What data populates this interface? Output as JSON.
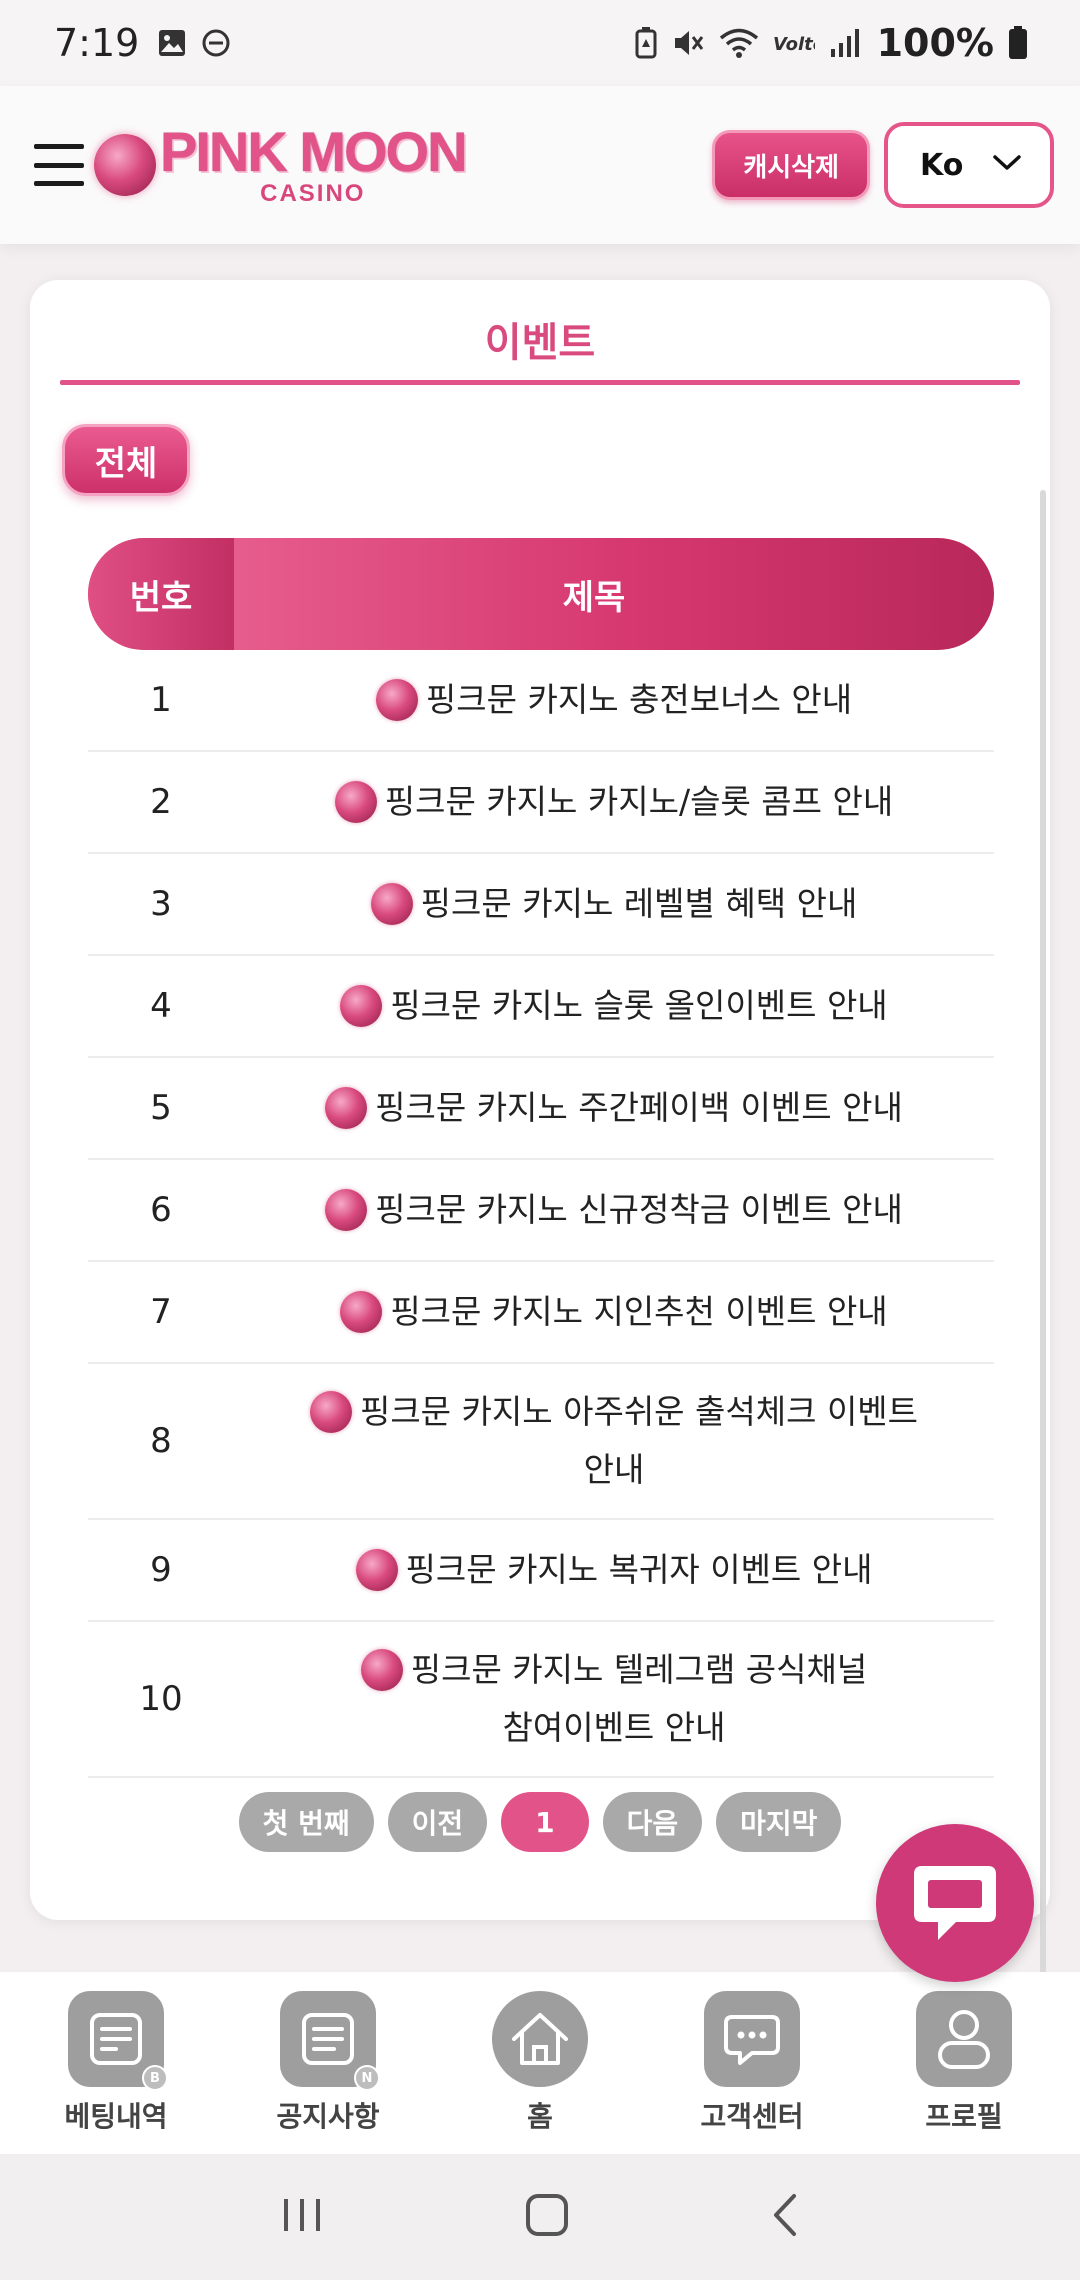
{
  "status_bar": {
    "time": "7:19",
    "battery_text": "100%",
    "left_icons": [
      "image-icon",
      "dnd-icon"
    ],
    "right_icons": [
      "battery-saver-icon",
      "mute-icon",
      "wifi-icon",
      "volte-icon",
      "signal-icon",
      "battery-icon"
    ]
  },
  "header": {
    "logo_main": "PINK MOON",
    "logo_sub": "CASINO",
    "cash_button": "캐시삭제",
    "language": "Ko"
  },
  "page": {
    "title": "이벤트",
    "filter_all": "전체"
  },
  "table": {
    "col_no": "번호",
    "col_title": "제목",
    "rows": [
      {
        "no": "1",
        "title": "핑크문 카지노 충전보너스 안내"
      },
      {
        "no": "2",
        "title": "핑크문 카지노 카지노/슬롯 콤프 안내"
      },
      {
        "no": "3",
        "title": "핑크문 카지노 레벨별 혜택 안내"
      },
      {
        "no": "4",
        "title": "핑크문 카지노 슬롯 올인이벤트 안내"
      },
      {
        "no": "5",
        "title": "핑크문 카지노 주간페이백 이벤트 안내"
      },
      {
        "no": "6",
        "title": "핑크문 카지노 신규정착금 이벤트 안내"
      },
      {
        "no": "7",
        "title": "핑크문 카지노 지인추천 이벤트 안내"
      },
      {
        "no": "8",
        "title": "핑크문 카지노 아주쉬운 출석체크 이벤트 안내"
      },
      {
        "no": "9",
        "title": "핑크문 카지노 복귀자 이벤트 안내"
      },
      {
        "no": "10",
        "title": "핑크문 카지노 텔레그램 공식채널 참여이벤트 안내"
      }
    ]
  },
  "pagination": {
    "first": "첫 번째",
    "prev": "이전",
    "current": "1",
    "next": "다음",
    "last": "마지막"
  },
  "bottom_nav": {
    "items": [
      {
        "label": "베팅내역",
        "icon": "betting-history-icon",
        "badge": "B"
      },
      {
        "label": "공지사항",
        "icon": "notice-icon",
        "badge": "N"
      },
      {
        "label": "홈",
        "icon": "home-icon"
      },
      {
        "label": "고객센터",
        "icon": "customer-center-icon"
      },
      {
        "label": "프로필",
        "icon": "profile-icon"
      }
    ]
  },
  "colors": {
    "accent": "#e25389",
    "accent_dark": "#c92f66",
    "chat_fab": "#cf3978",
    "nav_icon_gray": "#9e9e9e"
  }
}
